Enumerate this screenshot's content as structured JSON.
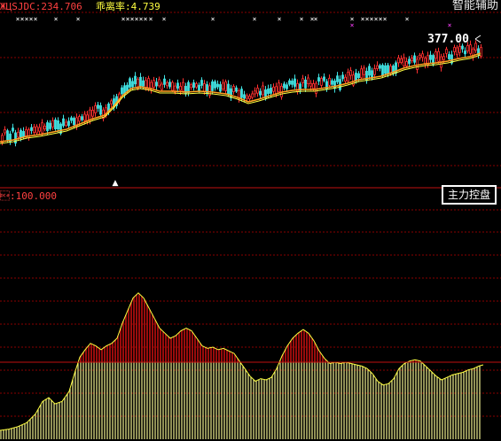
{
  "header": {
    "indicator_text": "ЖЦSJDC:234.706",
    "bias_text": "乖离率:4.739",
    "assist_label": "智能辅助"
  },
  "upper_panel": {
    "price_label": "377.00",
    "marker_glyph": "▲"
  },
  "lower_panel": {
    "value_text": "\u0014:100.000",
    "title": "主力控盘"
  },
  "colors": {
    "background": "#000000",
    "up_candle": "#ff3030",
    "down_candle": "#40e0e0",
    "ma_line": "#ffa020",
    "ma_line_2": "#ffff40",
    "grid": "#8a0000",
    "bar_red": "#c01010",
    "bar_yellow": "#f0f090",
    "curve": "#ffff40",
    "signal_x": "#ffffff",
    "signal_pink": "#ff40ff"
  },
  "chart_data": [
    {
      "type": "candlestick",
      "title": "",
      "last_price": 377.0,
      "trend": [
        [
          0,
          158
        ],
        [
          15,
          156
        ],
        [
          30,
          152
        ],
        [
          45,
          150
        ],
        [
          60,
          147
        ],
        [
          75,
          144
        ],
        [
          90,
          138
        ],
        [
          105,
          132
        ],
        [
          118,
          128
        ],
        [
          128,
          118
        ],
        [
          138,
          106
        ],
        [
          148,
          98
        ],
        [
          158,
          96
        ],
        [
          170,
          98
        ],
        [
          180,
          101
        ],
        [
          195,
          101
        ],
        [
          210,
          102
        ],
        [
          225,
          101
        ],
        [
          240,
          102
        ],
        [
          255,
          104
        ],
        [
          268,
          108
        ],
        [
          280,
          113
        ],
        [
          292,
          110
        ],
        [
          305,
          106
        ],
        [
          318,
          102
        ],
        [
          330,
          100
        ],
        [
          342,
          99
        ],
        [
          355,
          99
        ],
        [
          368,
          97
        ],
        [
          380,
          95
        ],
        [
          392,
          92
        ],
        [
          405,
          88
        ],
        [
          418,
          86
        ],
        [
          430,
          84
        ],
        [
          442,
          80
        ],
        [
          455,
          75
        ],
        [
          468,
          72
        ],
        [
          480,
          70
        ],
        [
          492,
          69
        ],
        [
          505,
          67
        ],
        [
          518,
          64
        ],
        [
          530,
          62
        ],
        [
          542,
          58
        ]
      ]
    },
    {
      "type": "bar",
      "title": "主力控盘",
      "ylim": [
        0,
        100
      ],
      "last_value": 100.0,
      "curve": [
        [
          0,
          7
        ],
        [
          10,
          8
        ],
        [
          20,
          10
        ],
        [
          30,
          13
        ],
        [
          40,
          20
        ],
        [
          48,
          30
        ],
        [
          55,
          33
        ],
        [
          62,
          28
        ],
        [
          70,
          30
        ],
        [
          78,
          38
        ],
        [
          84,
          52
        ],
        [
          90,
          65
        ],
        [
          96,
          71
        ],
        [
          102,
          76
        ],
        [
          108,
          74
        ],
        [
          114,
          71
        ],
        [
          120,
          74
        ],
        [
          126,
          76
        ],
        [
          132,
          80
        ],
        [
          138,
          92
        ],
        [
          144,
          102
        ],
        [
          150,
          112
        ],
        [
          156,
          116
        ],
        [
          162,
          112
        ],
        [
          168,
          104
        ],
        [
          174,
          96
        ],
        [
          180,
          88
        ],
        [
          186,
          84
        ],
        [
          192,
          80
        ],
        [
          198,
          82
        ],
        [
          204,
          86
        ],
        [
          210,
          88
        ],
        [
          216,
          86
        ],
        [
          222,
          80
        ],
        [
          228,
          74
        ],
        [
          234,
          72
        ],
        [
          240,
          73
        ],
        [
          246,
          71
        ],
        [
          252,
          72
        ],
        [
          258,
          70
        ],
        [
          264,
          68
        ],
        [
          270,
          62
        ],
        [
          276,
          56
        ],
        [
          282,
          50
        ],
        [
          288,
          46
        ],
        [
          294,
          48
        ],
        [
          300,
          47
        ],
        [
          306,
          49
        ],
        [
          312,
          56
        ],
        [
          318,
          66
        ],
        [
          324,
          74
        ],
        [
          330,
          80
        ],
        [
          336,
          84
        ],
        [
          342,
          87
        ],
        [
          348,
          84
        ],
        [
          354,
          78
        ],
        [
          360,
          70
        ],
        [
          366,
          64
        ],
        [
          372,
          60
        ],
        [
          378,
          61
        ],
        [
          384,
          60
        ],
        [
          390,
          61
        ],
        [
          396,
          60
        ],
        [
          402,
          59
        ],
        [
          408,
          58
        ],
        [
          414,
          56
        ],
        [
          420,
          52
        ],
        [
          426,
          46
        ],
        [
          432,
          43
        ],
        [
          438,
          44
        ],
        [
          444,
          48
        ],
        [
          450,
          56
        ],
        [
          456,
          60
        ],
        [
          462,
          62
        ],
        [
          468,
          63
        ],
        [
          474,
          62
        ],
        [
          480,
          58
        ],
        [
          486,
          54
        ],
        [
          492,
          50
        ],
        [
          498,
          47
        ],
        [
          504,
          49
        ],
        [
          510,
          51
        ],
        [
          516,
          52
        ],
        [
          522,
          53
        ],
        [
          528,
          55
        ],
        [
          534,
          56
        ],
        [
          540,
          58
        ],
        [
          545,
          59
        ]
      ]
    }
  ]
}
